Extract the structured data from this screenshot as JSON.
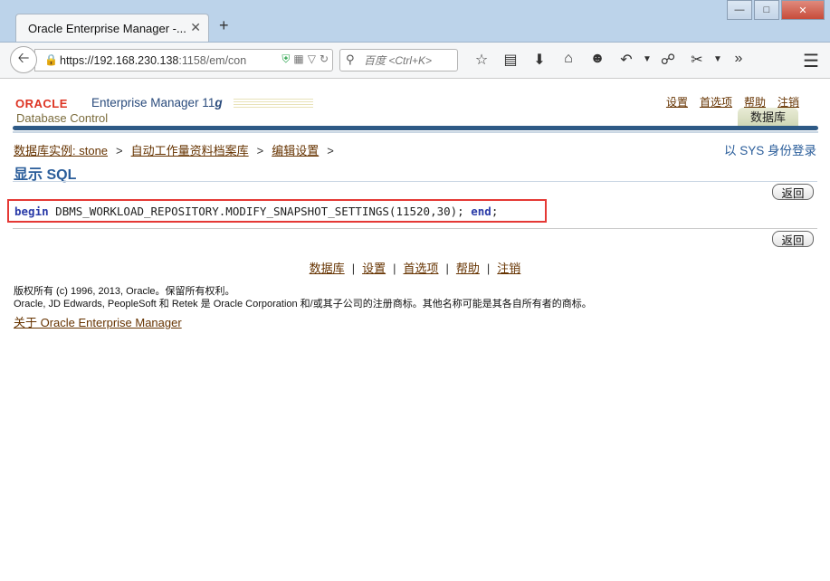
{
  "browser": {
    "tab_title": "Oracle Enterprise Manager -...",
    "tab_close": "✕",
    "new_tab": "+",
    "url_host": "https://192.168.230.138",
    "url_rest": ":1158/em/con",
    "search_placeholder": "百度 <Ctrl+K>"
  },
  "header": {
    "oracle_logo": "ORACLE",
    "em_title": "Enterprise Manager 11",
    "em_version": "g",
    "subtitle": "Database Control",
    "global_links": [
      "设置",
      "首选项",
      "帮助",
      "注销"
    ],
    "database_tab": "数据库"
  },
  "breadcrumb": {
    "items": [
      "数据库实例: stone",
      "自动工作量资料档案库",
      "编辑设置"
    ],
    "separator": ">"
  },
  "login_info": "以 SYS 身份登录",
  "page_title": "显示 SQL",
  "back_button": "返回",
  "sql": {
    "begin": "begin",
    "body": " DBMS_WORKLOAD_REPOSITORY.MODIFY_SNAPSHOT_SETTINGS(11520,30); ",
    "end": "end",
    "tail": ";"
  },
  "footer": {
    "links": [
      "数据库",
      "设置",
      "首选项",
      "帮助",
      "注销"
    ],
    "separator": "|",
    "copyright_line1": "版权所有 (c) 1996, 2013, Oracle。保留所有权利。",
    "copyright_line2": "Oracle, JD Edwards, PeopleSoft 和 Retek 是 Oracle Corporation 和/或其子公司的注册商标。其他名称可能是其各自所有者的商标。",
    "about_link": "关于 Oracle Enterprise Manager"
  }
}
